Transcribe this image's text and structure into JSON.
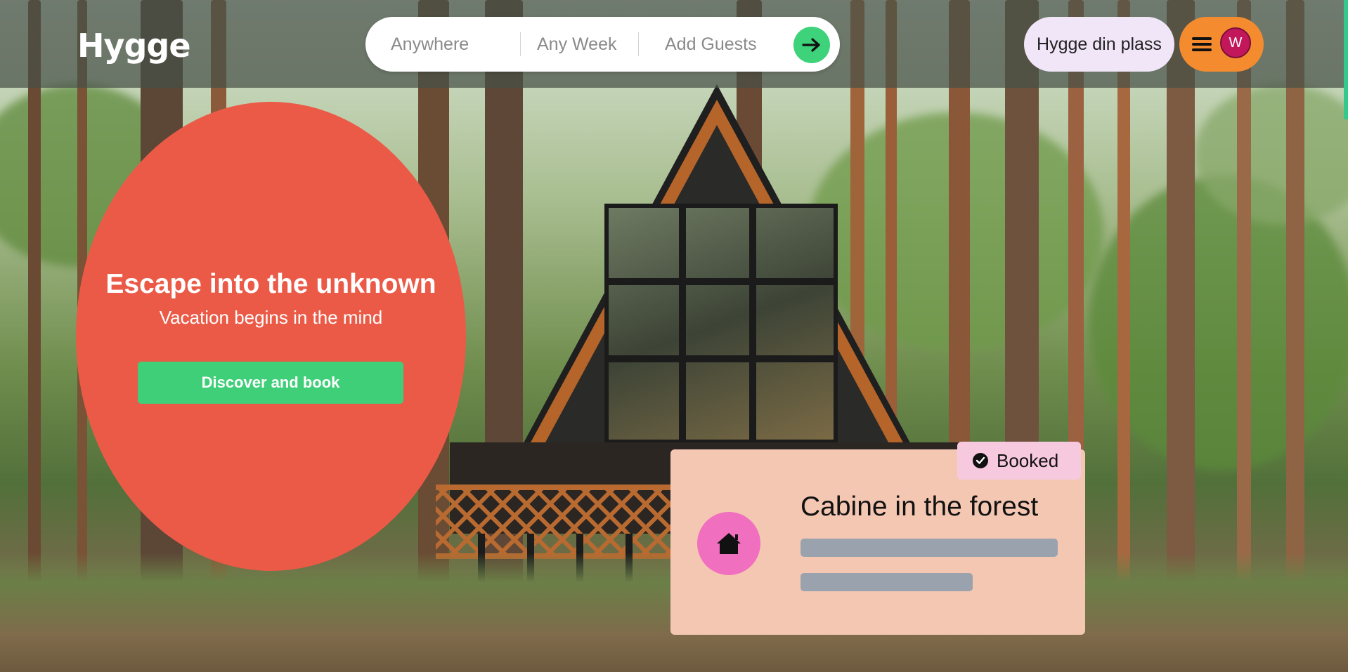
{
  "brand": {
    "logo": "Hygge"
  },
  "search": {
    "location": "Anywhere",
    "dates": "Any Week",
    "guests": "Add Guests",
    "submit_icon": "arrow-right-icon"
  },
  "header_actions": {
    "host_label": "Hygge din plass",
    "menu_icon": "hamburger-menu-icon",
    "avatar_initial": "W"
  },
  "hero": {
    "title": "Escape into the unknown",
    "subtitle": "Vacation begins in the mind",
    "cta_label": "Discover and book"
  },
  "booking_card": {
    "status": "Booked",
    "status_icon": "check-circle-icon",
    "home_icon": "home-icon",
    "title": "Cabine in the forest"
  },
  "colors": {
    "hero_bg": "#eb5a47",
    "cta_bg": "#3ecf78",
    "menu_bg": "#f58b2f",
    "host_bg": "#f1e5f8",
    "card_bg": "#f4c7b3",
    "badge_bg": "#f7c9de",
    "home_circle": "#f06fbf",
    "avatar_bg": "#c2185b"
  }
}
